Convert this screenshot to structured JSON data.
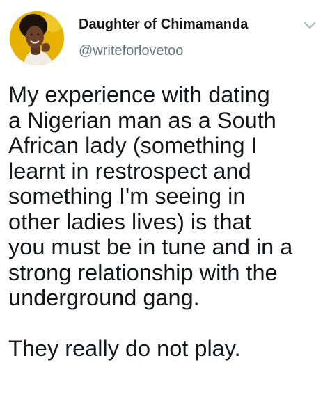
{
  "tweet": {
    "display_name": "Daughter of Chimamanda",
    "handle": "@writeforlovetoo",
    "text": "My experience with dating\na Nigerian man as a South\nAfrican lady (something I\nlearnt in restrospect and\nsomething I'm seeing in\nother ladies lives) is that\nyou must be in tune and in a\nstrong relationship with the\nunderground gang.\n\nThey really do not play.",
    "avatar_icon": "profile-photo",
    "menu_icon": "chevron-down-icon"
  },
  "colors": {
    "name": "#14171a",
    "handle": "#657786",
    "text": "#14171a",
    "avatar_bg": "#e9b400",
    "caret": "#aab8c2"
  }
}
